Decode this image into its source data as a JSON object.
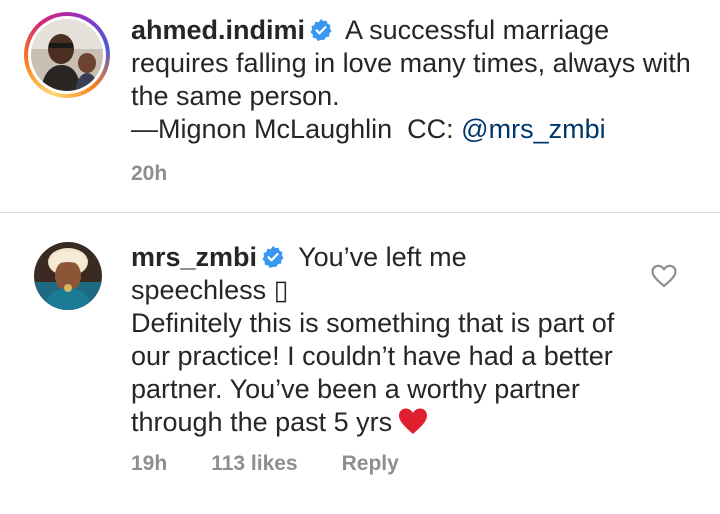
{
  "caption": {
    "username": "ahmed.indimi",
    "verified_icon": "verified-badge-icon",
    "text_line1": "A successful marriage",
    "text_rest": "requires falling in love many times, always with the same person.",
    "attribution": "—Mignon McLaughlin",
    "cc_label": "CC:",
    "mention": "@mrs_zmbi",
    "time": "20h"
  },
  "comment": {
    "username": "mrs_zmbi",
    "verified_icon": "verified-badge-icon",
    "text_line1": "You’ve left me",
    "text_line2": "speechless",
    "missing_glyph": "▯",
    "text_body": "Definitely this is something that is part of our practice! I couldn’t have had a better partner. You’ve been a worthy partner through the past 5 yrs",
    "emoji": "red-heart-icon",
    "time": "19h",
    "likes": "113 likes",
    "reply_label": "Reply",
    "like_icon": "heart-outline-icon"
  },
  "colors": {
    "text": "#262626",
    "meta": "#8e8e8e",
    "mention": "#00376b",
    "verified": "#3897f0",
    "heart": "#e0202f",
    "divider": "#dbdbdb"
  }
}
